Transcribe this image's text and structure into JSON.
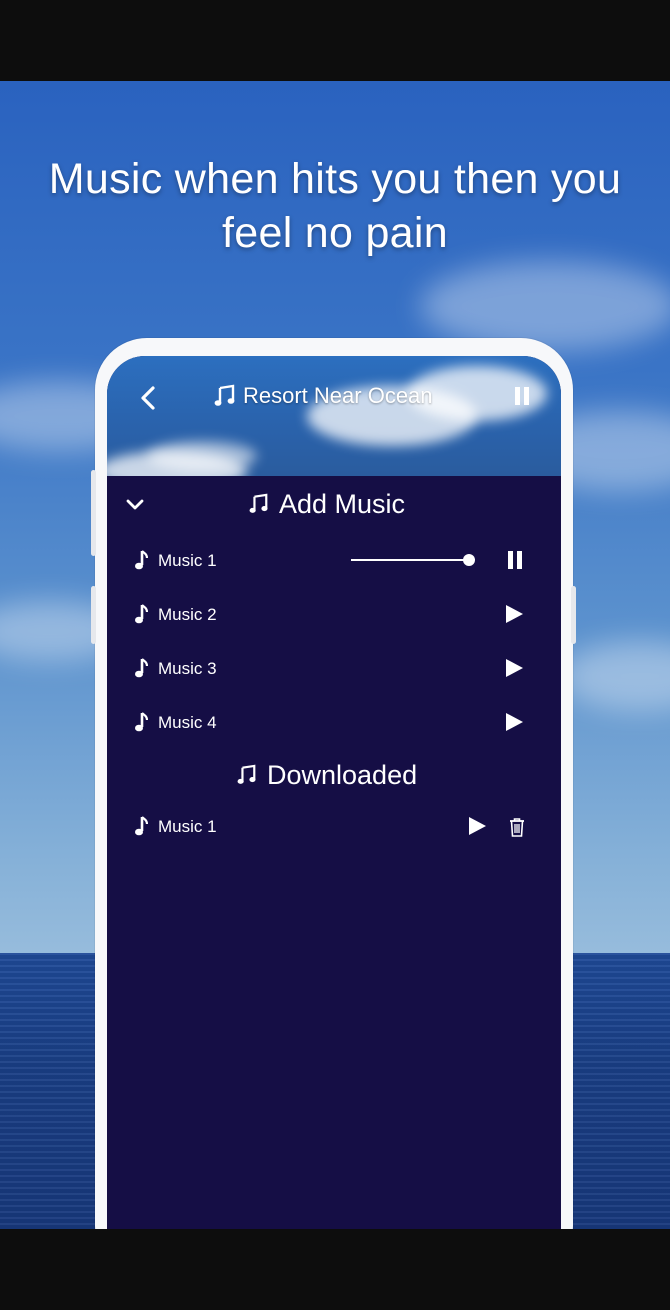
{
  "headline": {
    "line1": "Music when hits you then you",
    "line2": "feel no pain"
  },
  "app": {
    "header": {
      "title": "Resort Near Ocean",
      "back_icon": "chevron-left-icon",
      "note_icon": "music-notes-icon",
      "pause_icon": "pause-icon"
    },
    "add_music": {
      "title": "Add Music",
      "collapse_icon": "chevron-down-icon",
      "items": [
        {
          "label": "Music 1",
          "state": "playing",
          "progress": 1.0
        },
        {
          "label": "Music 2",
          "state": "stopped"
        },
        {
          "label": "Music 3",
          "state": "stopped"
        },
        {
          "label": "Music 4",
          "state": "stopped"
        }
      ]
    },
    "downloaded": {
      "title": "Downloaded",
      "items": [
        {
          "label": "Music 1",
          "state": "stopped",
          "delete_icon": "trash-icon"
        }
      ]
    }
  },
  "colors": {
    "list_background": "#150e45",
    "text": "#ffffff",
    "phone_frame": "#f7f8fa"
  }
}
